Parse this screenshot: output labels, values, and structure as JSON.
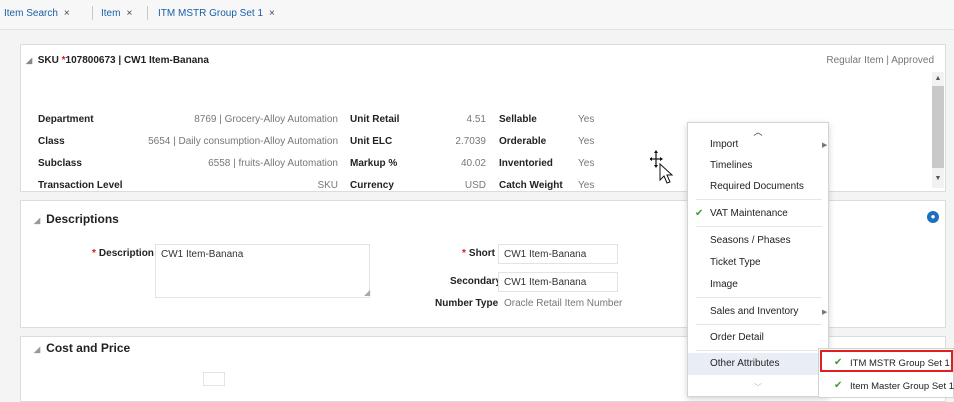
{
  "tabs": [
    {
      "label": "Item Search",
      "close": "×"
    },
    {
      "label": "Item",
      "close": "×"
    },
    {
      "label": "ITM MSTR Group Set 1",
      "close": "×"
    }
  ],
  "header": {
    "sku_label": "SKU",
    "sku_value": "107800673 | CW1 Item-Banana",
    "status": "Regular Item | Approved"
  },
  "attributes": {
    "col1": [
      {
        "label": "Department",
        "value": "8769 | Grocery-Alloy Automation"
      },
      {
        "label": "Class",
        "value": "5654 | Daily consumption-Alloy Automation"
      },
      {
        "label": "Subclass",
        "value": "6558 | fruits-Alloy Automation"
      },
      {
        "label": "Transaction Level",
        "value": "SKU"
      }
    ],
    "col2": [
      {
        "label": "Unit Retail",
        "value": "4.51"
      },
      {
        "label": "Unit ELC",
        "value": "2.7039"
      },
      {
        "label": "Markup %",
        "value": "40.02"
      },
      {
        "label": "Currency",
        "value": "USD"
      }
    ],
    "col3": [
      {
        "label": "Sellable",
        "value": "Yes"
      },
      {
        "label": "Orderable",
        "value": "Yes"
      },
      {
        "label": "Inventoried",
        "value": "Yes"
      },
      {
        "label": "Catch Weight",
        "value": "Yes"
      }
    ]
  },
  "descriptions": {
    "title": "Descriptions",
    "description_label": "Description",
    "description_value": "CW1 Item-Banana",
    "short_label": "Short",
    "short_value": "CW1 Item-Banana",
    "secondary_label": "Secondary",
    "secondary_value": "CW1 Item-Banana",
    "number_type_label": "Number Type",
    "number_type_value": "Oracle Retail Item Number"
  },
  "cost_price": {
    "title": "Cost and Price"
  },
  "menu": {
    "items": [
      {
        "label": "Import",
        "has_submenu": true,
        "checked": false
      },
      {
        "label": "Timelines",
        "has_submenu": false,
        "checked": false
      },
      {
        "label": "Required Documents",
        "has_submenu": false,
        "checked": false
      },
      {
        "label": "VAT Maintenance",
        "has_submenu": false,
        "checked": true
      },
      {
        "label": "Seasons / Phases",
        "has_submenu": false,
        "checked": false
      },
      {
        "label": "Ticket Type",
        "has_submenu": false,
        "checked": false
      },
      {
        "label": "Image",
        "has_submenu": false,
        "checked": false
      },
      {
        "label": "Sales and Inventory",
        "has_submenu": true,
        "checked": false
      },
      {
        "label": "Order Detail",
        "has_submenu": false,
        "checked": false
      },
      {
        "label": "Other Attributes",
        "has_submenu": true,
        "checked": false
      }
    ]
  },
  "submenu": {
    "items": [
      {
        "label": "ITM MSTR Group Set 1",
        "checked": true
      },
      {
        "label": "Item Master Group Set 1",
        "checked": true
      }
    ]
  },
  "icons": {
    "collapse": "collapse-triangle-icon",
    "help": "help-globe-icon",
    "check": "checkmark-icon",
    "submenu_arrow": "submenu-arrow-icon",
    "cursor": "move-cursor-icon"
  },
  "colors": {
    "link": "#1a5fa8",
    "required": "#d41a1a",
    "check": "#3f9c35",
    "highlight_border": "#e02020",
    "help_icon": "#1f6fbd"
  }
}
